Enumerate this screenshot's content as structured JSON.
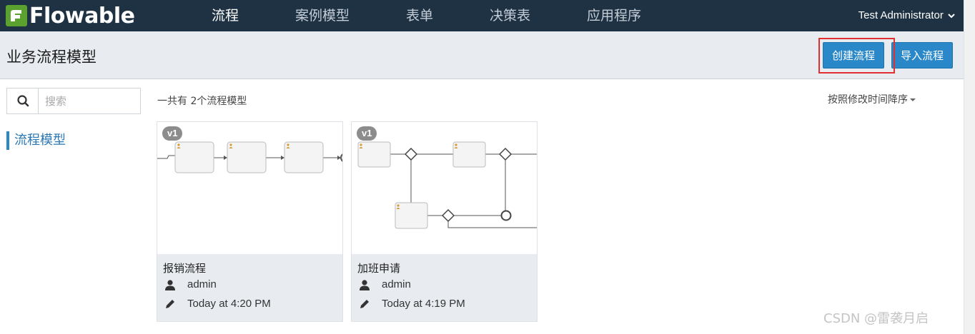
{
  "brand": {
    "logo_text": "Flowable",
    "brand_color": "#5aa12f"
  },
  "nav": {
    "items": [
      {
        "label": "流程",
        "active": true
      },
      {
        "label": "案例模型",
        "active": false
      },
      {
        "label": "表单",
        "active": false
      },
      {
        "label": "决策表",
        "active": false
      },
      {
        "label": "应用程序",
        "active": false
      }
    ],
    "user": "Test Administrator"
  },
  "header": {
    "title": "业务流程模型",
    "create_button": "创建流程",
    "import_button": "导入流程"
  },
  "sidebar": {
    "search_placeholder": "搜索",
    "link": "流程模型"
  },
  "main": {
    "count_text": "一共有 2个流程模型",
    "sort_label": "按照修改时间降序"
  },
  "cards": [
    {
      "version": "v1",
      "name": "报销流程",
      "owner": "admin",
      "modified": "Today at 4:20 PM"
    },
    {
      "version": "v1",
      "name": "加班申请",
      "owner": "admin",
      "modified": "Today at 4:19 PM"
    }
  ],
  "watermark": "CSDN @雷袭月启",
  "colors": {
    "accent": "#2a88c8",
    "nav_bg": "#1f3244",
    "highlight": "#e03030"
  }
}
